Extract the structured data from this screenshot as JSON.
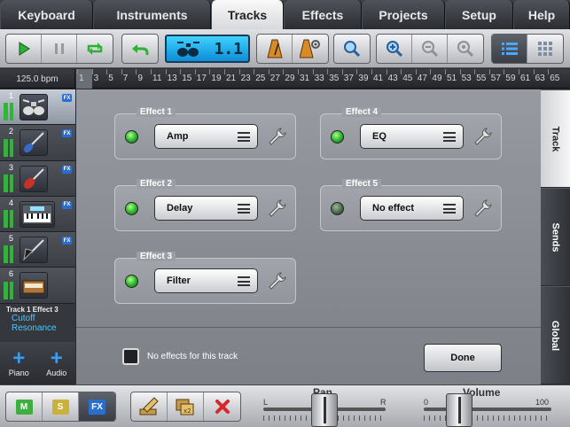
{
  "top_tabs": [
    {
      "label": "Keyboard",
      "active": false
    },
    {
      "label": "Instruments",
      "active": false
    },
    {
      "label": "Tracks",
      "active": true
    },
    {
      "label": "Effects",
      "active": false
    },
    {
      "label": "Projects",
      "active": false
    },
    {
      "label": "Setup",
      "active": false
    },
    {
      "label": "Help",
      "active": false
    }
  ],
  "toolbar": {
    "lcd_value": "1.1",
    "buttons": [
      "play-icon",
      "pause-icon",
      "loop-icon",
      "undo-icon",
      "metronome-icon",
      "metronome-settings-icon",
      "search-icon",
      "zoom-in-icon",
      "zoom-out-icon",
      "zoom-reset-icon",
      "list-view-icon",
      "grid-view-icon"
    ]
  },
  "ruler": {
    "bpm": "125.0 bpm",
    "numbers": [
      "1",
      "3",
      "5",
      "7",
      "9",
      "11",
      "13",
      "15",
      "17",
      "19",
      "21",
      "23",
      "25",
      "27",
      "29",
      "31",
      "33",
      "35",
      "37",
      "39",
      "41",
      "43",
      "45",
      "47",
      "49",
      "51",
      "53",
      "55",
      "57",
      "59",
      "61",
      "63",
      "65"
    ]
  },
  "tracks": [
    {
      "number": "1",
      "instrument": "drums-icon",
      "selected": true
    },
    {
      "number": "2",
      "instrument": "bass-guitar-icon",
      "selected": false
    },
    {
      "number": "3",
      "instrument": "electric-guitar-icon",
      "selected": false
    },
    {
      "number": "4",
      "instrument": "synth-keyboard-icon",
      "selected": false
    },
    {
      "number": "5",
      "instrument": "flying-v-guitar-icon",
      "selected": false
    },
    {
      "number": "6",
      "instrument": "piano-icon",
      "selected": false
    }
  ],
  "fx_badge": "FX",
  "info": {
    "title": "Track 1 Effect 3",
    "params": [
      "Cutoff",
      "Resonance"
    ]
  },
  "add_buttons": [
    {
      "label": "Piano"
    },
    {
      "label": "Audio"
    }
  ],
  "effects": [
    {
      "title": "Effect 1",
      "value": "Amp",
      "led": "on"
    },
    {
      "title": "Effect 2",
      "value": "Delay",
      "led": "on"
    },
    {
      "title": "Effect 3",
      "value": "Filter",
      "led": "on"
    },
    {
      "title": "Effect 4",
      "value": "EQ",
      "led": "on"
    },
    {
      "title": "Effect 5",
      "value": "No effect",
      "led": "off"
    }
  ],
  "no_effects_label": "No effects for this track",
  "done_label": "Done",
  "side_tabs": [
    {
      "label": "Track",
      "active": true
    },
    {
      "label": "Sends",
      "active": false
    },
    {
      "label": "Global",
      "active": false
    }
  ],
  "bottom": {
    "mute": "M",
    "solo": "S",
    "fx": "FX",
    "pan": {
      "title": "Pan",
      "left": "L",
      "right": "R",
      "value": 0.5
    },
    "volume": {
      "title": "Volume",
      "min": "0",
      "max": "100",
      "value": 0.28
    }
  },
  "colors": {
    "accent_blue": "#2a6fcf",
    "led_green": "#2bb12b",
    "lcd_blue": "#1aa4ea",
    "param_cyan": "#48c9ff"
  }
}
